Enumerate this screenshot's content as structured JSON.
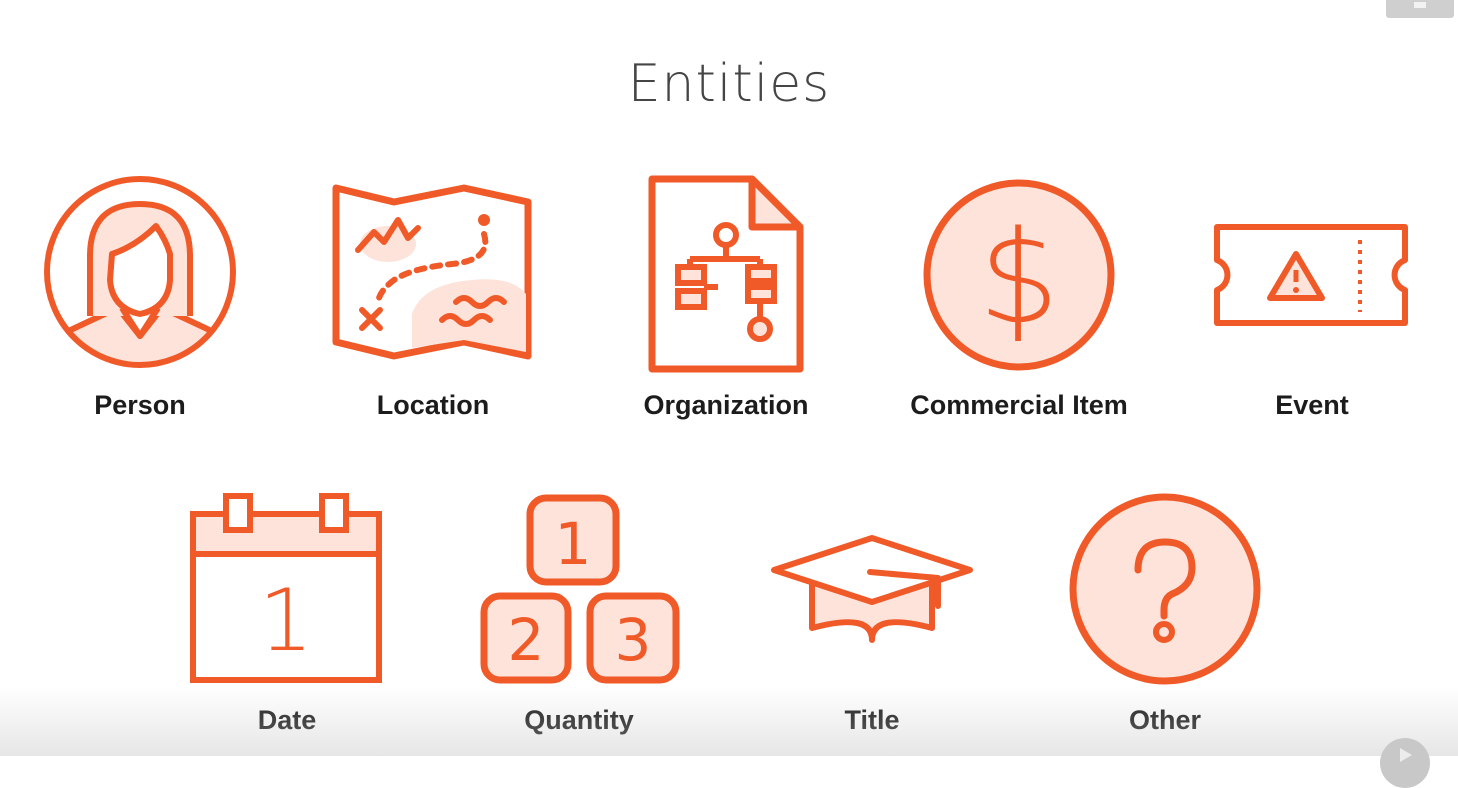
{
  "slide": {
    "title": "Entities"
  },
  "colors": {
    "accent": "#f05a28",
    "accent_fill": "#fde3da",
    "text": "#1c1c1c"
  },
  "entities": [
    {
      "label": "Person",
      "icon": "person-icon"
    },
    {
      "label": "Location",
      "icon": "map-icon"
    },
    {
      "label": "Organization",
      "icon": "org-chart-document-icon"
    },
    {
      "label": "Commercial Item",
      "icon": "dollar-coin-icon"
    },
    {
      "label": "Event",
      "icon": "ticket-icon"
    },
    {
      "label": "Date",
      "icon": "calendar-icon"
    },
    {
      "label": "Quantity",
      "icon": "number-blocks-icon"
    },
    {
      "label": "Title",
      "icon": "graduation-cap-icon"
    },
    {
      "label": "Other",
      "icon": "question-circle-icon"
    }
  ],
  "icon_text": {
    "calendar_day": "1",
    "block_1": "1",
    "block_2": "2",
    "block_3": "3",
    "question_mark": "?",
    "dollar": "$",
    "warning": "!"
  }
}
